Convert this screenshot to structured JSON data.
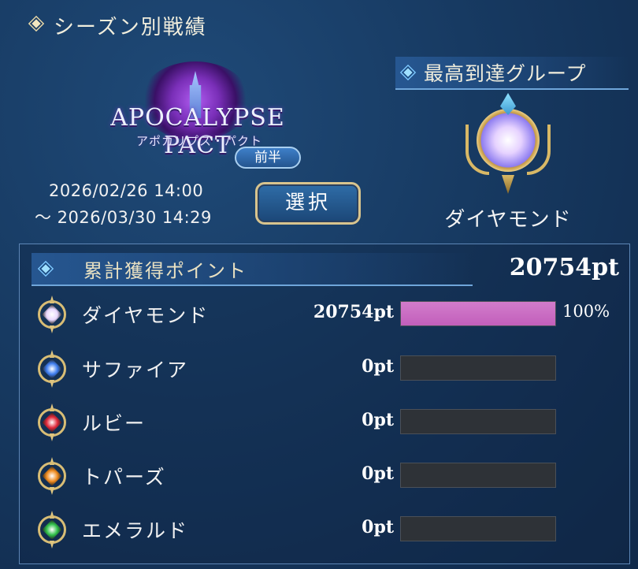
{
  "header": {
    "title": "シーズン別戦績"
  },
  "season": {
    "logo_title": "APOCALYPSE PACT",
    "logo_subtitle": "アポカリプス・パクト",
    "phase_tag": "前半",
    "date_start": "2026/02/26 14:00",
    "date_end": "〜 2026/03/30 14:29",
    "select_label": "選択"
  },
  "group": {
    "title": "最高到達グループ",
    "name": "ダイヤモンド",
    "icon": "diamond-rank-emblem"
  },
  "points": {
    "label": "累計獲得ポイント",
    "total": "20754pt",
    "rows": [
      {
        "name": "ダイヤモンド",
        "points": "20754pt",
        "percent_text": "100%",
        "fill": 1.0,
        "gem_color": "#e9d8ff",
        "icon": "diamond-gem-icon"
      },
      {
        "name": "サファイア",
        "points": "0pt",
        "percent_text": "",
        "fill": 0,
        "gem_color": "#3d7df0",
        "icon": "sapphire-gem-icon"
      },
      {
        "name": "ルビー",
        "points": "0pt",
        "percent_text": "",
        "fill": 0,
        "gem_color": "#e0283a",
        "icon": "ruby-gem-icon"
      },
      {
        "name": "トパーズ",
        "points": "0pt",
        "percent_text": "",
        "fill": 0,
        "gem_color": "#f08a1e",
        "icon": "topaz-gem-icon"
      },
      {
        "name": "エメラルド",
        "points": "0pt",
        "percent_text": "",
        "fill": 0,
        "gem_color": "#2fbf4a",
        "icon": "emerald-gem-icon"
      }
    ]
  },
  "colors": {
    "bar_fill": "#c25fbb",
    "bar_empty": "#2e3237",
    "accent_gold": "#d8c48e"
  }
}
